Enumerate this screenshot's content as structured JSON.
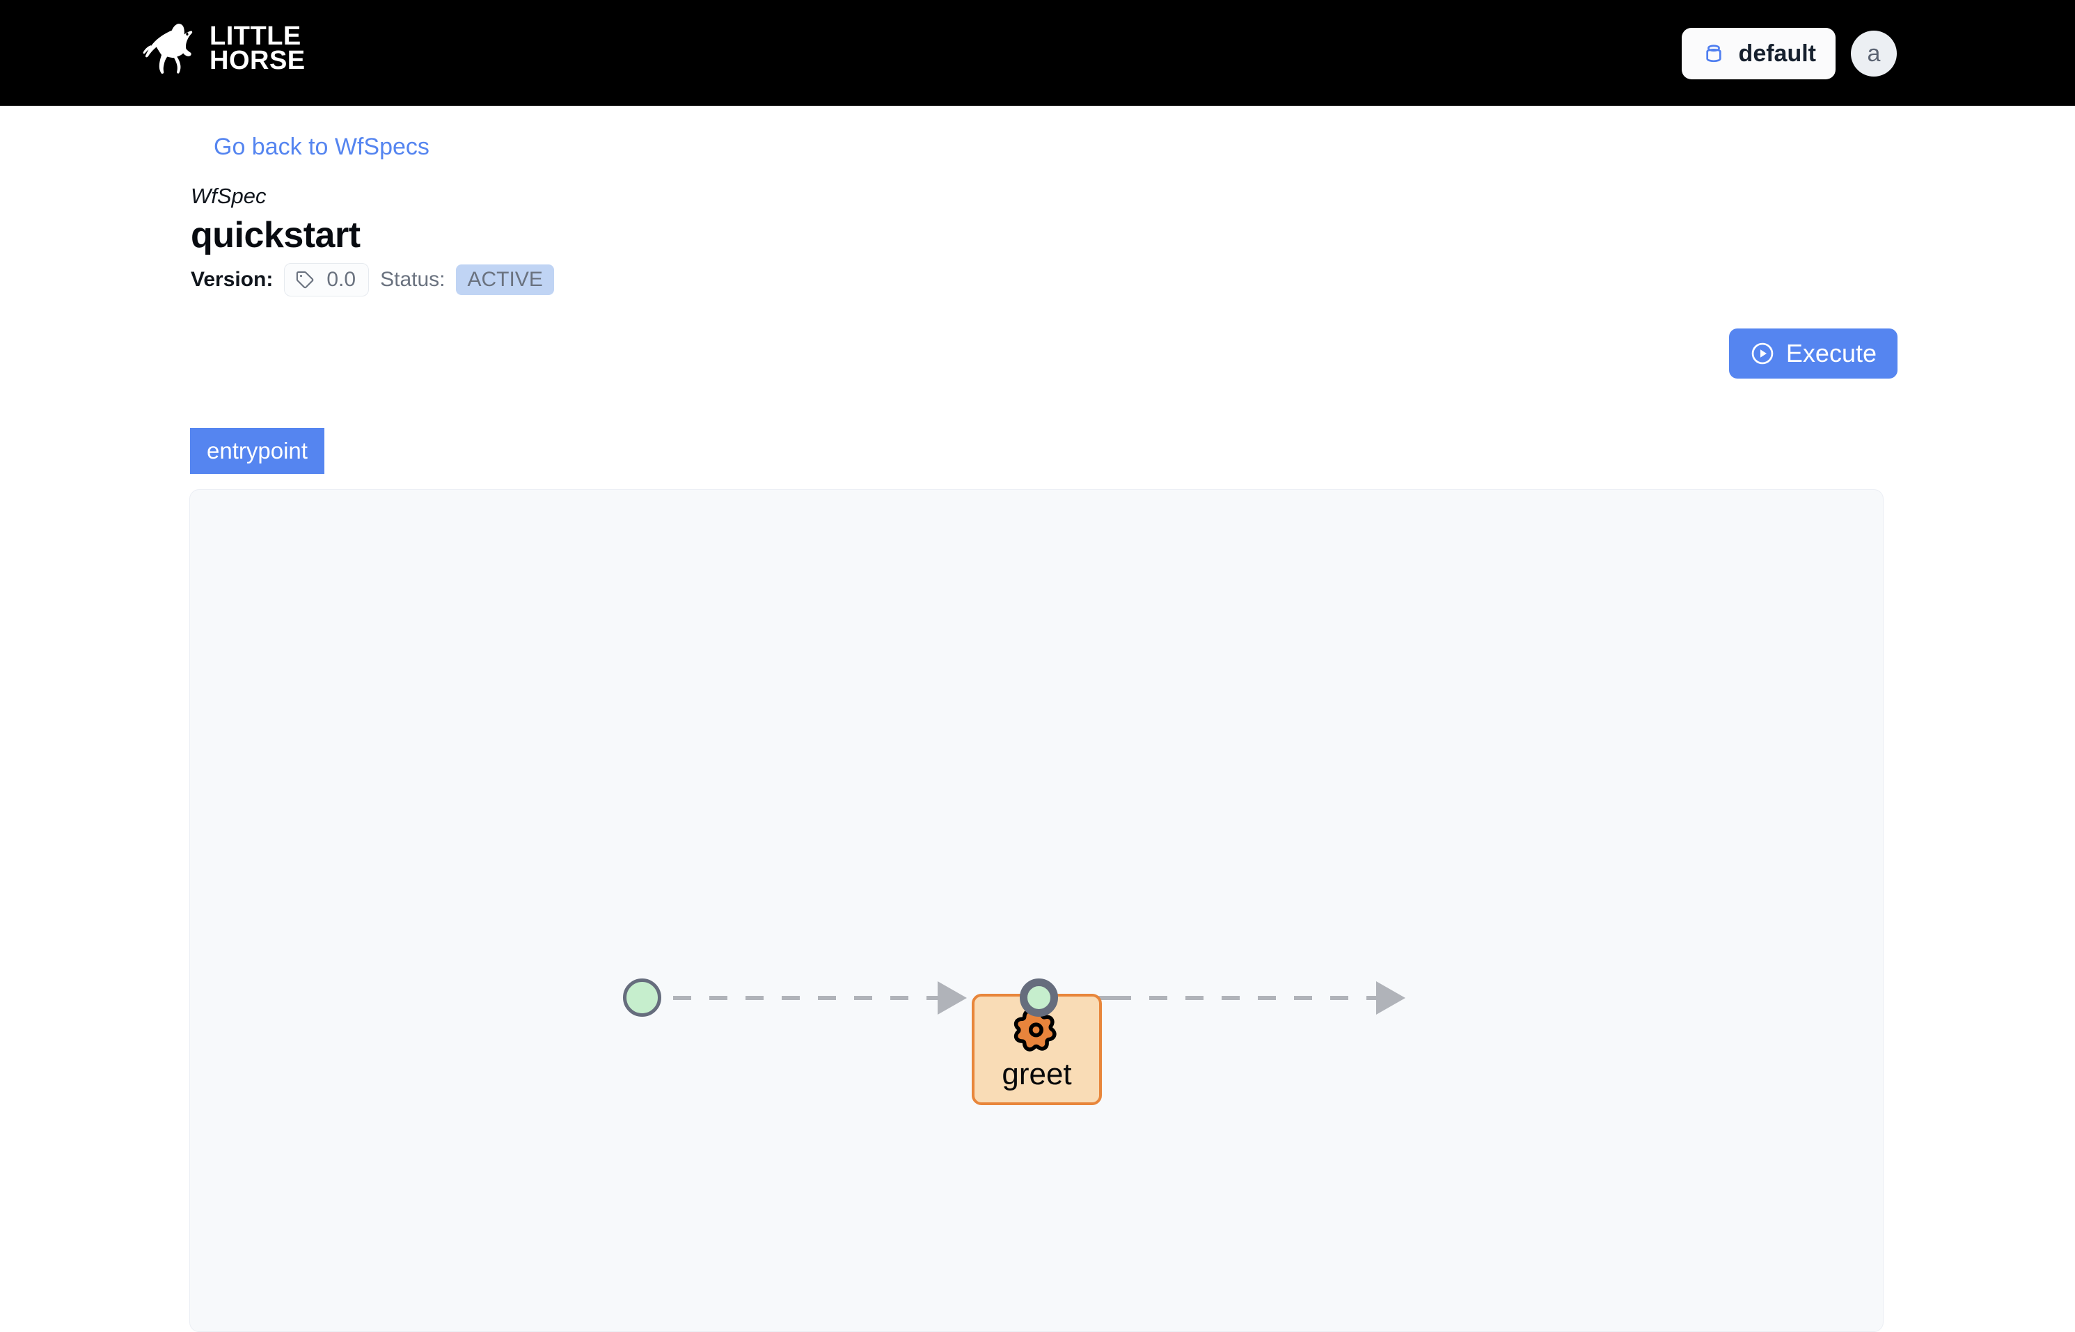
{
  "app": {
    "brand_line1": "LITTLE",
    "brand_line2": "HORSE",
    "logo_icon": "running-horse-logo"
  },
  "header": {
    "tenant_label": "default",
    "tenant_icon": "database-icon",
    "avatar_initial": "a"
  },
  "nav": {
    "back_link": "Go back to WfSpecs"
  },
  "spec": {
    "kind": "WfSpec",
    "name": "quickstart",
    "version_key": "Version:",
    "version_icon": "tag-icon",
    "version_value": "0.0",
    "status_key": "Status:",
    "status_value": "ACTIVE"
  },
  "actions": {
    "execute_label": "Execute",
    "execute_icon": "play-circle-icon"
  },
  "tabs": [
    {
      "label": "entrypoint",
      "active": true
    }
  ],
  "diagram": {
    "nodes": [
      {
        "id": "start",
        "type": "start-event",
        "label": ""
      },
      {
        "id": "greet",
        "type": "task",
        "label": "greet",
        "icon": "gear-icon"
      },
      {
        "id": "end",
        "type": "end-event",
        "label": ""
      }
    ],
    "edges": [
      {
        "from": "start",
        "to": "greet",
        "style": "dashed"
      },
      {
        "from": "greet",
        "to": "end",
        "style": "dashed"
      }
    ]
  },
  "colors": {
    "accent_blue": "#5585f0",
    "header_black": "#000000",
    "node_green": "#c6eecd",
    "node_stroke": "#666d7d",
    "task_fill": "#f9dcb6",
    "task_stroke": "#e8863b",
    "status_badge_bg": "#c0d4f4",
    "canvas_bg": "#f7f9fb",
    "edge_gray": "#b0b3b9"
  }
}
